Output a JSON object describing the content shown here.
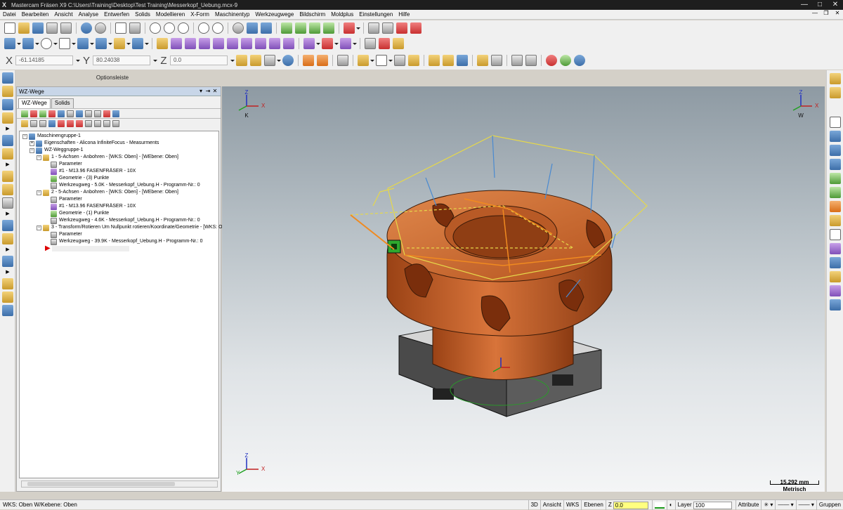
{
  "window": {
    "title": "Mastercam Fräsen X9  C:\\Users\\Training\\Desktop\\Test Training\\Messerkopf_Uebung.mcx-9"
  },
  "menu": [
    "Datei",
    "Bearbeiten",
    "Ansicht",
    "Analyse",
    "Entwerfen",
    "Solids",
    "Modellieren",
    "X-Form",
    "Maschinentyp",
    "Werkzeugwege",
    "Bildschirm",
    "Moldplus",
    "Einstellungen",
    "Hilfe"
  ],
  "coords": {
    "x_label": "X",
    "x_value": "-61.14185",
    "y_label": "Y",
    "y_value": "80.24038",
    "z_label": "Z",
    "z_value": "0.0"
  },
  "optionsleiste": "Optionsleiste",
  "panel": {
    "title": "WZ-Wege",
    "tabs": [
      "WZ-Wege",
      "Solids"
    ],
    "tree": [
      "Maschinengruppe-1",
      "Eigenschaften - Alicona InfiniteFocus - Measurments",
      "WZ-Weggruppe-1",
      "1 - 5-Achsen - Anbohren - [WKS: Oben] - [WEbene: Oben]",
      "Parameter",
      "#1 - M13.96 FASENFRÄSER - 10X",
      "Geometrie - (3) Punkte",
      "Werkzeugweg - 5.0K - Messerkopf_Uebung.H - Programm-Nr.: 0",
      "2 - 5-Achsen - Anbohren - [WKS: Oben] - [WEbene: Oben]",
      "Parameter",
      "#1 - M13.96 FASENFRÄSER - 10X",
      "Geometrie - (1) Punkte",
      "Werkzeugweg - 4.6K - Messerkopf_Uebung.H - Programm-Nr.: 0",
      "3 - Transform/Rotieren Um Nullpunkt rotieren/Koordinate/Geometrie - [WKS: O",
      "Parameter",
      "Werkzeugweg - 39.9K - Messerkopf_Uebung.H - Programm-Nr.: 0"
    ]
  },
  "viewport": {
    "triad_labels": {
      "x": "X",
      "y": "Y",
      "z": "Z",
      "k": "K",
      "w": "W"
    },
    "scale_value": "15.292 mm",
    "scale_unit": "Metrisch"
  },
  "status": {
    "left": "WKS: Oben  W/Kebene: Oben",
    "mode": "3D",
    "view": "Ansicht",
    "wks": "WKS",
    "planes": "Ebenen",
    "z_label": "Z",
    "z_value": "0.0",
    "layer_label": "Layer",
    "layer_value": "100",
    "attr": "Attribute",
    "groups": "Gruppen"
  },
  "colors": {
    "part": "#c8612a",
    "base": "#4a4a4a",
    "toolpath_yellow": "#e6d84a",
    "toolpath_orange": "#f08a20",
    "toolpath_blue": "#4a8ad0"
  }
}
